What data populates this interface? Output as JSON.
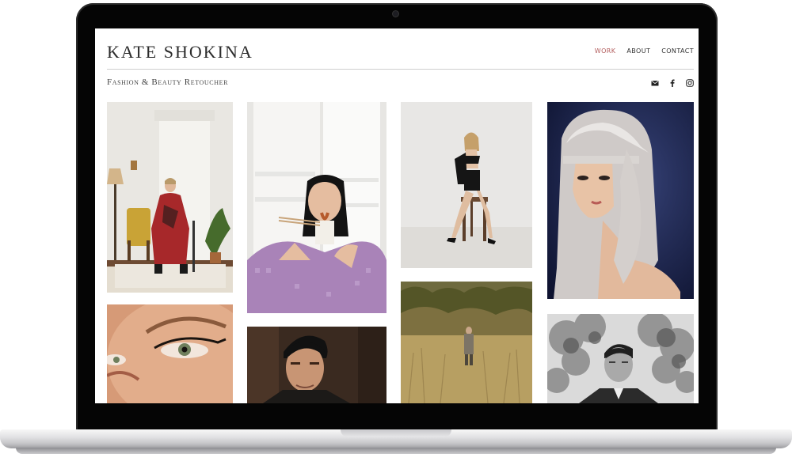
{
  "site": {
    "title": "KATE SHOKINA",
    "tagline": "Fashion & Beauty Retoucher"
  },
  "nav": {
    "items": [
      {
        "label": "WORK",
        "active": true
      },
      {
        "label": "ABOUT",
        "active": false
      },
      {
        "label": "CONTACT",
        "active": false
      }
    ]
  },
  "social": [
    "envelope-icon",
    "facebook-icon",
    "instagram-icon"
  ],
  "colors": {
    "accent": "#b25c5c",
    "text": "#2c2c2c",
    "rule": "#cfcfcf"
  },
  "gallery": [
    {
      "name": "photo-woman-red-dress-chair"
    },
    {
      "name": "photo-woman-eating-noodles"
    },
    {
      "name": "photo-model-black-lingerie-stool"
    },
    {
      "name": "photo-platinum-hair-beauty"
    },
    {
      "name": "photo-eye-makeup-closeup"
    },
    {
      "name": "photo-man-portrait-dark"
    },
    {
      "name": "photo-man-in-field"
    },
    {
      "name": "photo-man-black-white-trees"
    }
  ]
}
